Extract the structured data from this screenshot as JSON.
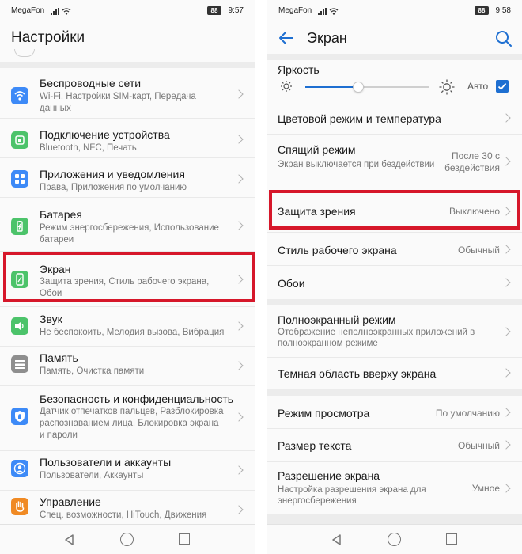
{
  "status_left": {
    "carrier": "MegaFon",
    "battery": "88",
    "time": "9:57"
  },
  "status_right": {
    "carrier": "MegaFon",
    "battery": "88",
    "time": "9:58"
  },
  "left": {
    "title": "Настройки",
    "items": [
      {
        "label": "Беспроводные сети",
        "sub": "Wi-Fi, Настройки SIM-карт, Передача данных",
        "icon": "wifi-icon",
        "color": "#3d8af7"
      },
      {
        "label": "Подключение устройства",
        "sub": "Bluetooth, NFC, Печать",
        "icon": "device-connection-icon",
        "color": "#4cc36a"
      },
      {
        "label": "Приложения и уведомления",
        "sub": "Права, Приложения по умолчанию",
        "icon": "apps-icon",
        "color": "#3d8af7"
      },
      {
        "label": "Батарея",
        "sub": "Режим энергосбережения, Использование батареи",
        "icon": "battery-icon",
        "color": "#4cc36a"
      },
      {
        "label": "Экран",
        "sub": "Защита зрения, Стиль рабочего экрана, Обои",
        "icon": "display-icon",
        "color": "#4cc36a"
      },
      {
        "label": "Звук",
        "sub": "Не беспокоить, Мелодия вызова, Вибрация",
        "icon": "sound-icon",
        "color": "#4cc36a"
      },
      {
        "label": "Память",
        "sub": "Память, Очистка памяти",
        "icon": "memory-icon",
        "color": "#8e8e8e"
      },
      {
        "label": "Безопасность и конфиденциальность",
        "sub": "Датчик отпечатков пальцев, Разблокировка распознаванием лица, Блокировка экрана и пароли",
        "icon": "security-icon",
        "color": "#3d8af7"
      },
      {
        "label": "Пользователи и аккаунты",
        "sub": "Пользователи, Аккаунты",
        "icon": "users-icon",
        "color": "#3d8af7"
      },
      {
        "label": "Управление",
        "sub": "Спец. возможности, HiTouch, Движения",
        "icon": "hand-icon",
        "color": "#f08a24"
      }
    ]
  },
  "right": {
    "title": "Экран",
    "brightness": {
      "label": "Яркость",
      "auto_label": "Авто",
      "level": 0.43
    },
    "items": [
      {
        "label": "Цветовой режим и температура",
        "sub": "",
        "value": ""
      },
      {
        "label": "Спящий режим",
        "sub": "Экран выключается при бездействии",
        "value": "После 30 с бездействия"
      },
      {
        "label": "Защита зрения",
        "sub": "",
        "value": "Выключено"
      },
      {
        "label": "Стиль рабочего экрана",
        "sub": "",
        "value": "Обычный"
      },
      {
        "label": "Обои",
        "sub": "",
        "value": ""
      },
      {
        "label": "Полноэкранный режим",
        "sub": "Отображение неполноэкранных приложений в полноэкранном режиме",
        "value": ""
      },
      {
        "label": "Темная область вверху экрана",
        "sub": "",
        "value": ""
      },
      {
        "label": "Режим просмотра",
        "sub": "",
        "value": "По умолчанию"
      },
      {
        "label": "Размер текста",
        "sub": "",
        "value": "Обычный"
      },
      {
        "label": "Разрешение экрана",
        "sub": "Настройка разрешения экрана для энергосбережения",
        "value": "Умное"
      }
    ]
  },
  "colors": {
    "accent": "#1e6fd1",
    "highlight": "#d6172a"
  }
}
